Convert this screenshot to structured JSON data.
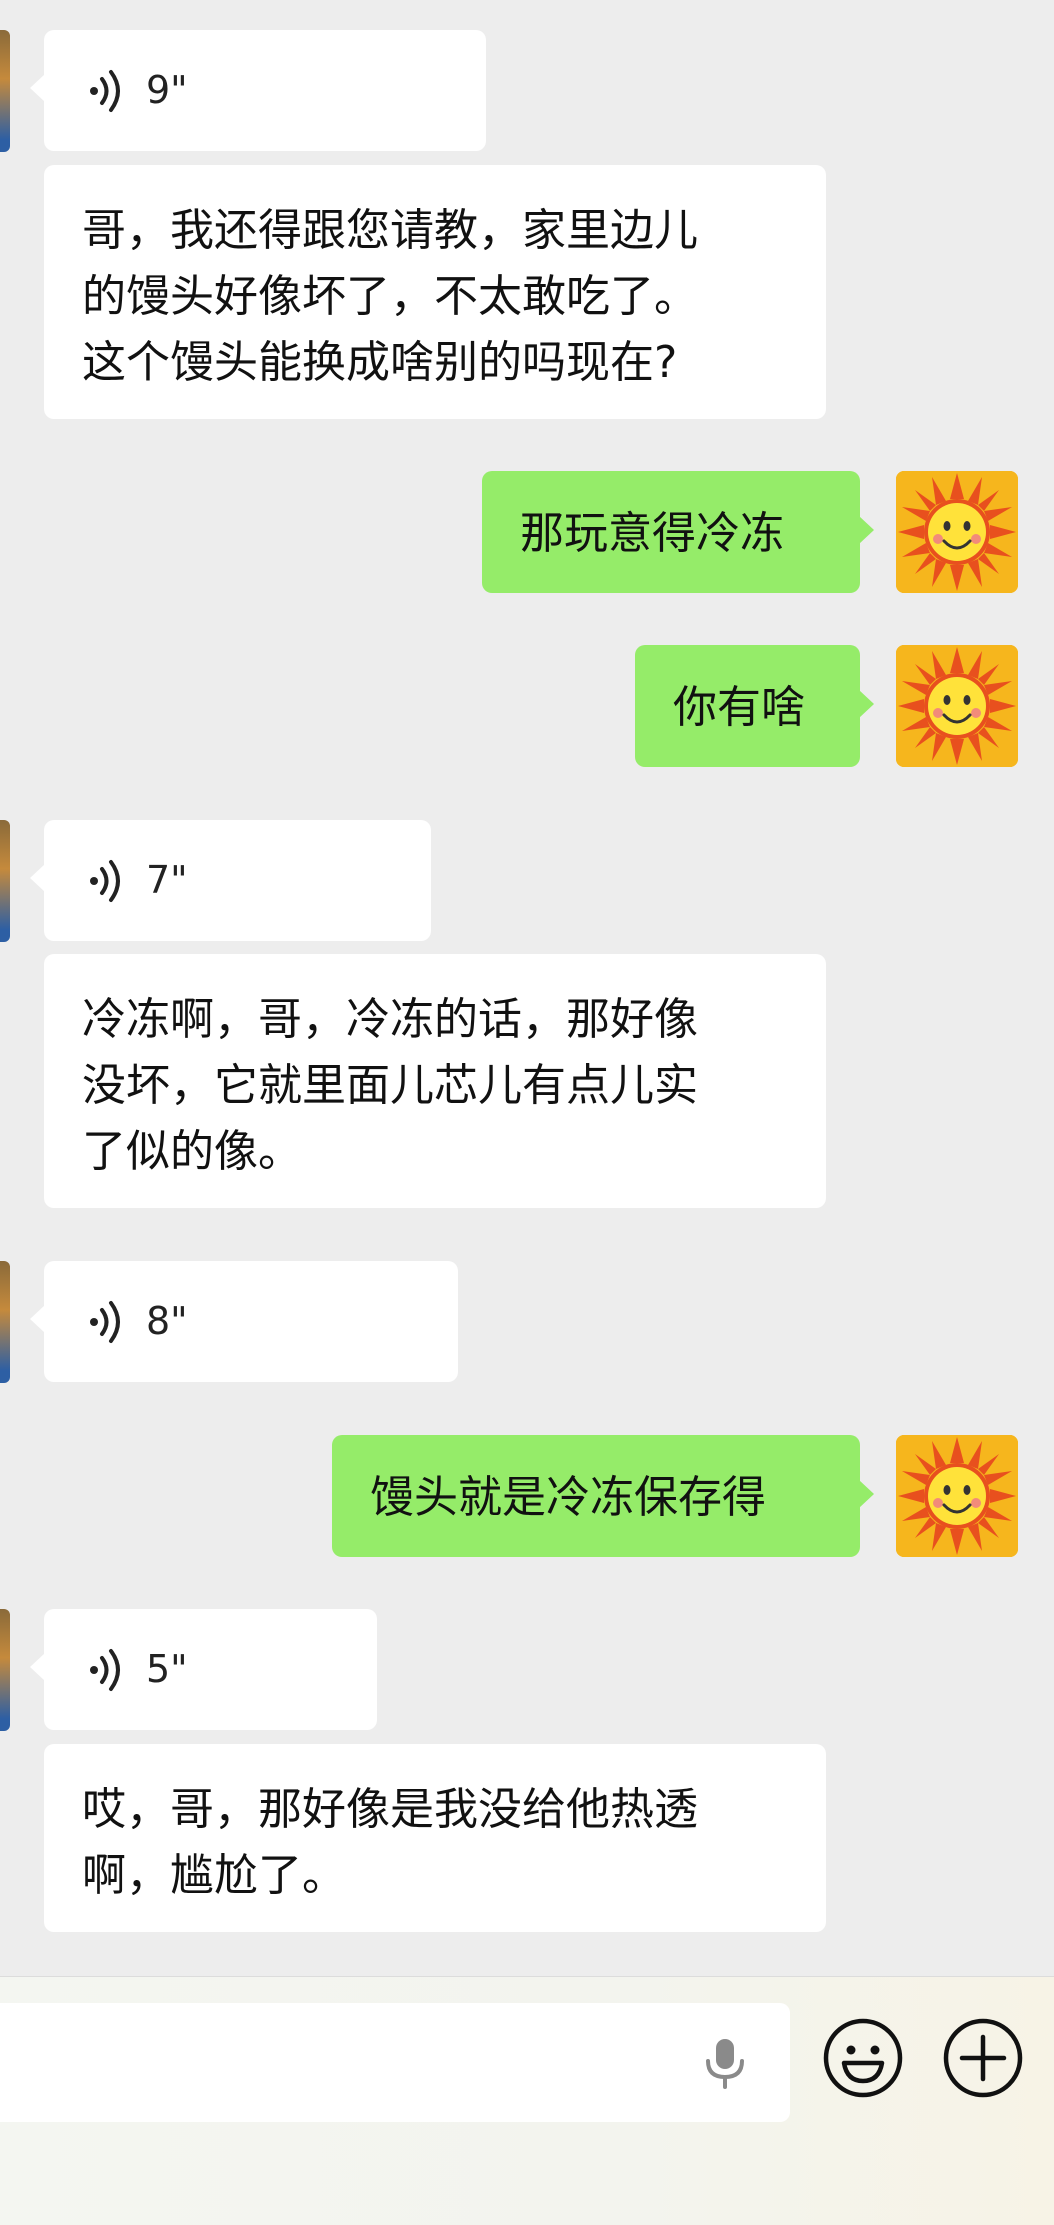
{
  "messages": [
    {
      "side": "in",
      "type": "voice",
      "duration": "9\""
    },
    {
      "side": "in",
      "type": "text",
      "lines": [
        "哥，我还得跟您请教，家里边儿",
        "的馒头好像坏了，不太敢吃了。",
        "这个馒头能换成啥别的吗现在?"
      ]
    },
    {
      "side": "out",
      "type": "text",
      "lines": [
        "那玩意得冷冻"
      ]
    },
    {
      "side": "out",
      "type": "text",
      "lines": [
        "你有啥"
      ]
    },
    {
      "side": "in",
      "type": "voice",
      "duration": "7\""
    },
    {
      "side": "in",
      "type": "text",
      "lines": [
        "冷冻啊，哥，冷冻的话，那好像",
        "没坏，它就里面儿芯儿有点儿实",
        "了似的像。"
      ]
    },
    {
      "side": "in",
      "type": "voice",
      "duration": "8\""
    },
    {
      "side": "out",
      "type": "text",
      "lines": [
        "馒头就是冷冻保存得"
      ]
    },
    {
      "side": "in",
      "type": "voice",
      "duration": "5\""
    },
    {
      "side": "in",
      "type": "text",
      "lines": [
        "哎，哥，那好像是我没给他热透",
        "啊，尴尬了。"
      ]
    }
  ],
  "icons": {
    "voice": "voice-wave-icon",
    "mic": "microphone-icon",
    "emoji": "emoji-icon",
    "plus": "plus-icon",
    "avatar_self": "sun-avatar"
  },
  "colors": {
    "background": "#ededed",
    "incoming_bubble": "#ffffff",
    "outgoing_bubble": "#95ec69"
  }
}
